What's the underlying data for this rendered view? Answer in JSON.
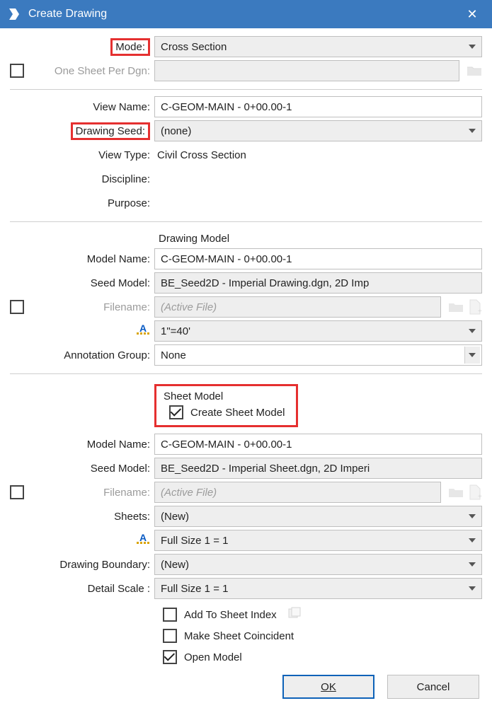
{
  "window": {
    "title": "Create Drawing"
  },
  "mode": {
    "label": "Mode:",
    "value": "Cross Section"
  },
  "oneSheet": {
    "label": "One Sheet Per Dgn:",
    "value": ""
  },
  "viewName": {
    "label": "View Name:",
    "value": "C-GEOM-MAIN - 0+00.00-1"
  },
  "drawingSeed": {
    "label": "Drawing Seed:",
    "value": "(none)"
  },
  "viewType": {
    "label": "View Type:",
    "value": "Civil Cross Section"
  },
  "discipline": {
    "label": "Discipline:",
    "value": ""
  },
  "purpose": {
    "label": "Purpose:",
    "value": ""
  },
  "drawingModel": {
    "header": "Drawing Model",
    "modelName": {
      "label": "Model Name:",
      "value": "C-GEOM-MAIN - 0+00.00-1"
    },
    "seedModel": {
      "label": "Seed Model:",
      "value": "BE_Seed2D - Imperial Drawing.dgn, 2D Imp"
    },
    "filename": {
      "label": "Filename:",
      "value": "(Active File)"
    },
    "scale": {
      "value": "1\"=40'"
    },
    "annotationGroup": {
      "label": "Annotation Group:",
      "value": "None"
    }
  },
  "sheetModel": {
    "header": "Sheet Model",
    "createLabel": "Create Sheet Model",
    "modelName": {
      "label": "Model Name:",
      "value": "C-GEOM-MAIN - 0+00.00-1"
    },
    "seedModel": {
      "label": "Seed Model:",
      "value": "BE_Seed2D - Imperial Sheet.dgn, 2D Imperi"
    },
    "filename": {
      "label": "Filename:",
      "value": "(Active File)"
    },
    "sheets": {
      "label": "Sheets:",
      "value": "(New)"
    },
    "scale": {
      "value": "Full Size 1 = 1"
    },
    "drawingBoundary": {
      "label": "Drawing Boundary:",
      "value": "(New)"
    },
    "detailScale": {
      "label": "Detail Scale :",
      "value": "Full Size 1 = 1"
    }
  },
  "options": {
    "addToSheetIndex": "Add To Sheet Index",
    "makeSheetCoincident": "Make Sheet Coincident",
    "openModel": "Open Model"
  },
  "buttons": {
    "ok": "OK",
    "cancel": "Cancel"
  },
  "colors": {
    "highlight": "#e52f2f",
    "titlebar": "#3b7abf"
  }
}
